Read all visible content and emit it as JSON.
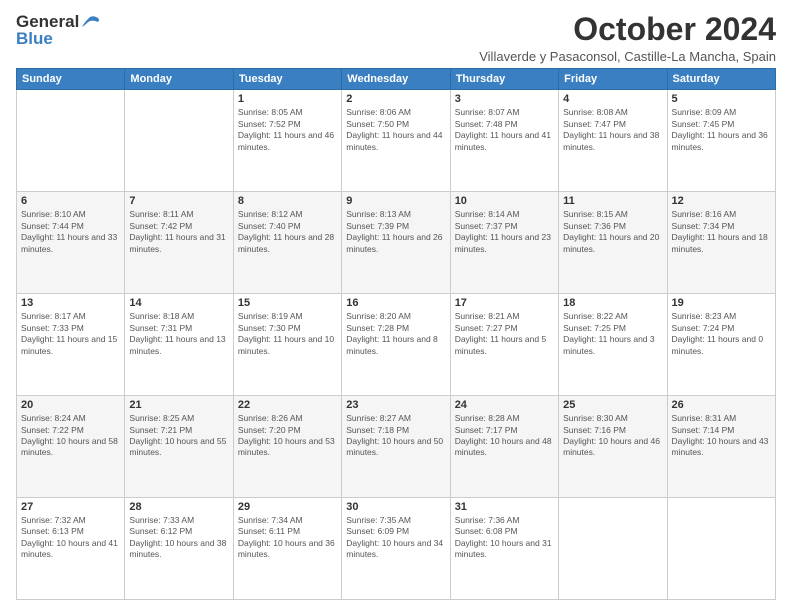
{
  "logo": {
    "line1": "General",
    "line2": "Blue"
  },
  "title": "October 2024",
  "subtitle": "Villaverde y Pasaconsol, Castille-La Mancha, Spain",
  "days_header": [
    "Sunday",
    "Monday",
    "Tuesday",
    "Wednesday",
    "Thursday",
    "Friday",
    "Saturday"
  ],
  "weeks": [
    [
      {
        "day": "",
        "info": ""
      },
      {
        "day": "",
        "info": ""
      },
      {
        "day": "1",
        "info": "Sunrise: 8:05 AM\nSunset: 7:52 PM\nDaylight: 11 hours and 46 minutes."
      },
      {
        "day": "2",
        "info": "Sunrise: 8:06 AM\nSunset: 7:50 PM\nDaylight: 11 hours and 44 minutes."
      },
      {
        "day": "3",
        "info": "Sunrise: 8:07 AM\nSunset: 7:48 PM\nDaylight: 11 hours and 41 minutes."
      },
      {
        "day": "4",
        "info": "Sunrise: 8:08 AM\nSunset: 7:47 PM\nDaylight: 11 hours and 38 minutes."
      },
      {
        "day": "5",
        "info": "Sunrise: 8:09 AM\nSunset: 7:45 PM\nDaylight: 11 hours and 36 minutes."
      }
    ],
    [
      {
        "day": "6",
        "info": "Sunrise: 8:10 AM\nSunset: 7:44 PM\nDaylight: 11 hours and 33 minutes."
      },
      {
        "day": "7",
        "info": "Sunrise: 8:11 AM\nSunset: 7:42 PM\nDaylight: 11 hours and 31 minutes."
      },
      {
        "day": "8",
        "info": "Sunrise: 8:12 AM\nSunset: 7:40 PM\nDaylight: 11 hours and 28 minutes."
      },
      {
        "day": "9",
        "info": "Sunrise: 8:13 AM\nSunset: 7:39 PM\nDaylight: 11 hours and 26 minutes."
      },
      {
        "day": "10",
        "info": "Sunrise: 8:14 AM\nSunset: 7:37 PM\nDaylight: 11 hours and 23 minutes."
      },
      {
        "day": "11",
        "info": "Sunrise: 8:15 AM\nSunset: 7:36 PM\nDaylight: 11 hours and 20 minutes."
      },
      {
        "day": "12",
        "info": "Sunrise: 8:16 AM\nSunset: 7:34 PM\nDaylight: 11 hours and 18 minutes."
      }
    ],
    [
      {
        "day": "13",
        "info": "Sunrise: 8:17 AM\nSunset: 7:33 PM\nDaylight: 11 hours and 15 minutes."
      },
      {
        "day": "14",
        "info": "Sunrise: 8:18 AM\nSunset: 7:31 PM\nDaylight: 11 hours and 13 minutes."
      },
      {
        "day": "15",
        "info": "Sunrise: 8:19 AM\nSunset: 7:30 PM\nDaylight: 11 hours and 10 minutes."
      },
      {
        "day": "16",
        "info": "Sunrise: 8:20 AM\nSunset: 7:28 PM\nDaylight: 11 hours and 8 minutes."
      },
      {
        "day": "17",
        "info": "Sunrise: 8:21 AM\nSunset: 7:27 PM\nDaylight: 11 hours and 5 minutes."
      },
      {
        "day": "18",
        "info": "Sunrise: 8:22 AM\nSunset: 7:25 PM\nDaylight: 11 hours and 3 minutes."
      },
      {
        "day": "19",
        "info": "Sunrise: 8:23 AM\nSunset: 7:24 PM\nDaylight: 11 hours and 0 minutes."
      }
    ],
    [
      {
        "day": "20",
        "info": "Sunrise: 8:24 AM\nSunset: 7:22 PM\nDaylight: 10 hours and 58 minutes."
      },
      {
        "day": "21",
        "info": "Sunrise: 8:25 AM\nSunset: 7:21 PM\nDaylight: 10 hours and 55 minutes."
      },
      {
        "day": "22",
        "info": "Sunrise: 8:26 AM\nSunset: 7:20 PM\nDaylight: 10 hours and 53 minutes."
      },
      {
        "day": "23",
        "info": "Sunrise: 8:27 AM\nSunset: 7:18 PM\nDaylight: 10 hours and 50 minutes."
      },
      {
        "day": "24",
        "info": "Sunrise: 8:28 AM\nSunset: 7:17 PM\nDaylight: 10 hours and 48 minutes."
      },
      {
        "day": "25",
        "info": "Sunrise: 8:30 AM\nSunset: 7:16 PM\nDaylight: 10 hours and 46 minutes."
      },
      {
        "day": "26",
        "info": "Sunrise: 8:31 AM\nSunset: 7:14 PM\nDaylight: 10 hours and 43 minutes."
      }
    ],
    [
      {
        "day": "27",
        "info": "Sunrise: 7:32 AM\nSunset: 6:13 PM\nDaylight: 10 hours and 41 minutes."
      },
      {
        "day": "28",
        "info": "Sunrise: 7:33 AM\nSunset: 6:12 PM\nDaylight: 10 hours and 38 minutes."
      },
      {
        "day": "29",
        "info": "Sunrise: 7:34 AM\nSunset: 6:11 PM\nDaylight: 10 hours and 36 minutes."
      },
      {
        "day": "30",
        "info": "Sunrise: 7:35 AM\nSunset: 6:09 PM\nDaylight: 10 hours and 34 minutes."
      },
      {
        "day": "31",
        "info": "Sunrise: 7:36 AM\nSunset: 6:08 PM\nDaylight: 10 hours and 31 minutes."
      },
      {
        "day": "",
        "info": ""
      },
      {
        "day": "",
        "info": ""
      }
    ]
  ]
}
